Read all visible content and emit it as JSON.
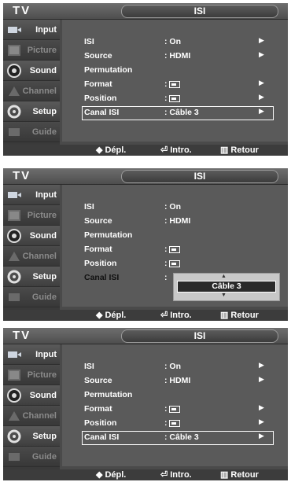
{
  "tv_label": "TV",
  "title": "ISI",
  "sidebar": [
    {
      "label": "Input",
      "icon": "input-icon",
      "enabled": true
    },
    {
      "label": "Picture",
      "icon": "picture-icon",
      "enabled": false
    },
    {
      "label": "Sound",
      "icon": "sound-icon",
      "enabled": true
    },
    {
      "label": "Channel",
      "icon": "channel-icon",
      "enabled": false
    },
    {
      "label": "Setup",
      "icon": "setup-icon",
      "enabled": true
    },
    {
      "label": "Guide",
      "icon": "guide-icon",
      "enabled": false
    }
  ],
  "rows": [
    {
      "label": "ISI",
      "value": ": On"
    },
    {
      "label": "Source",
      "value": ": HDMI"
    },
    {
      "label": "Permutation",
      "value": ""
    },
    {
      "label": "Format",
      "value": ":"
    },
    {
      "label": "Position",
      "value": ":"
    },
    {
      "label": "Canal ISI",
      "value": ": Câble 3"
    }
  ],
  "panel2_canal_value": ":",
  "popup_option": "Câble 3",
  "hints": {
    "move": "Dépl.",
    "enter": "Intro.",
    "return": "Retour"
  }
}
